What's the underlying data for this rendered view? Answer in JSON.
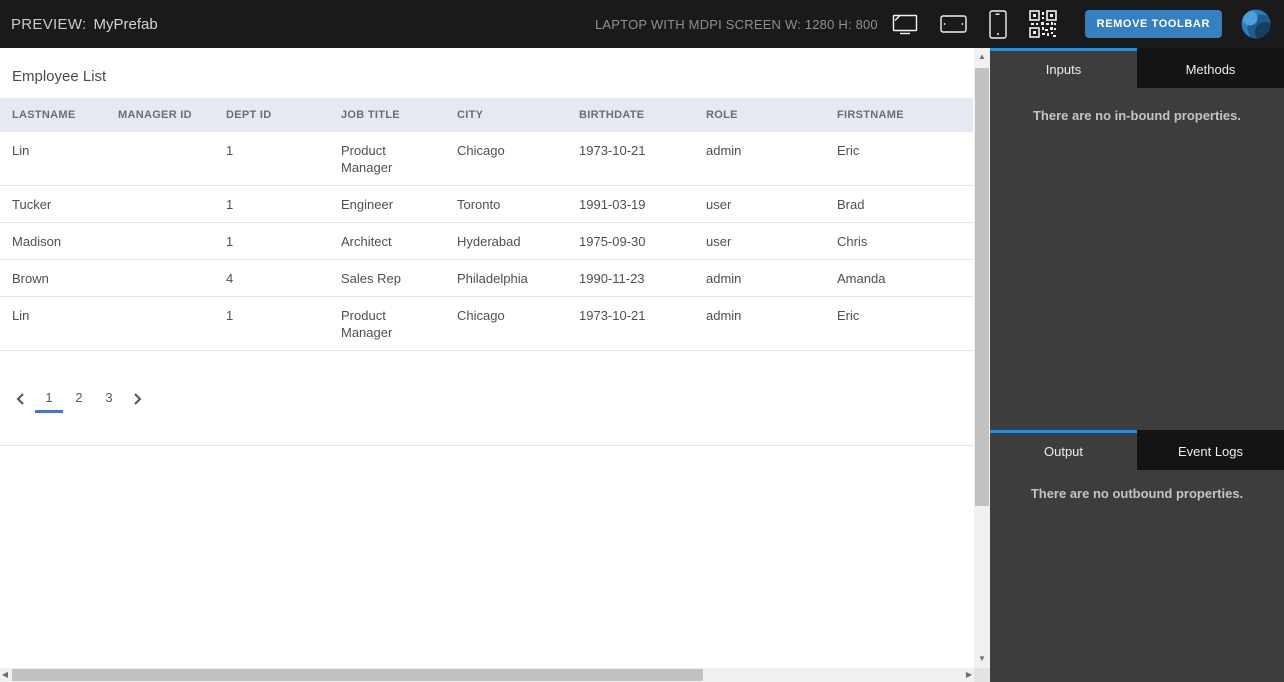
{
  "toolbar": {
    "preview_label": "PREVIEW:",
    "app_name": "MyPrefab",
    "device_label": "LAPTOP WITH MDPI SCREEN W: 1280 H: 800",
    "device_icons": [
      "laptop-icon",
      "tablet-icon",
      "phone-icon",
      "qr-code-icon"
    ],
    "remove_toolbar_label": "REMOVE TOOLBAR"
  },
  "preview": {
    "title": "Employee List",
    "table": {
      "columns": [
        "LASTNAME",
        "MANAGER ID",
        "DEPT ID",
        "JOB TITLE",
        "CITY",
        "BIRTHDATE",
        "ROLE",
        "FIRSTNAME"
      ],
      "rows": [
        [
          "Lin",
          "",
          "1",
          "Product Manager",
          "Chicago",
          "1973-10-21",
          "admin",
          "Eric"
        ],
        [
          "Tucker",
          "",
          "1",
          "Engineer",
          "Toronto",
          "1991-03-19",
          "user",
          "Brad"
        ],
        [
          "Madison",
          "",
          "1",
          "Architect",
          "Hyderabad",
          "1975-09-30",
          "user",
          "Chris"
        ],
        [
          "Brown",
          "",
          "4",
          "Sales Rep",
          "Philadelphia",
          "1990-11-23",
          "admin",
          "Amanda"
        ],
        [
          "Lin",
          "",
          "1",
          "Product Manager",
          "Chicago",
          "1973-10-21",
          "admin",
          "Eric"
        ]
      ]
    },
    "pagination": {
      "pages": [
        "1",
        "2",
        "3"
      ],
      "current": "1"
    }
  },
  "panel": {
    "top_tabs": [
      {
        "label": "Inputs",
        "active": true
      },
      {
        "label": "Methods",
        "active": false
      }
    ],
    "top_message": "There are no in-bound properties.",
    "bottom_tabs": [
      {
        "label": "Output",
        "active": true
      },
      {
        "label": "Event Logs",
        "active": false
      }
    ],
    "bottom_message": "There are no outbound properties."
  },
  "colors": {
    "toolbar_bg": "#1a1a1a",
    "panel_bg": "#3d3d3d",
    "inactive_tab_bg": "#141414",
    "accent_blue": "#2e8ad2",
    "button_blue": "#3580c1",
    "pagination_underline": "#4d6fc4",
    "table_header_bg": "#e6e9f1"
  }
}
